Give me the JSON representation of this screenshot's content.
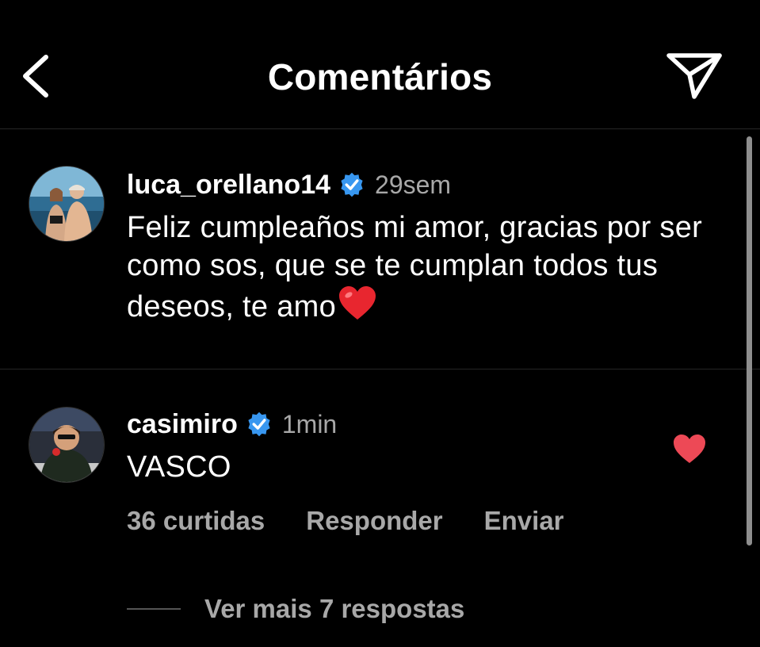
{
  "header": {
    "title": "Comentários",
    "back_icon": "chevron-left-icon",
    "share_icon": "paper-plane-icon"
  },
  "comments": [
    {
      "username": "luca_orellano14",
      "verified": true,
      "time": "29sem",
      "text": "Feliz cumpleaños mi amor, gracias por ser como sos, que se te cumplan todos tus deseos, te amo",
      "emoji": "red-heart-emoji"
    },
    {
      "username": "casimiro",
      "verified": true,
      "time": "1min",
      "text": "VASCO",
      "liked": true,
      "likes_label": "36 curtidas",
      "reply_label": "Responder",
      "send_label": "Enviar",
      "view_replies_label": "Ver mais 7 respostas"
    }
  ],
  "colors": {
    "background": "#000000",
    "text": "#ffffff",
    "secondary_text": "#a8a8a8",
    "verified_badge": "#3897f0",
    "like_red": "#ed4956",
    "divider": "#262626"
  }
}
